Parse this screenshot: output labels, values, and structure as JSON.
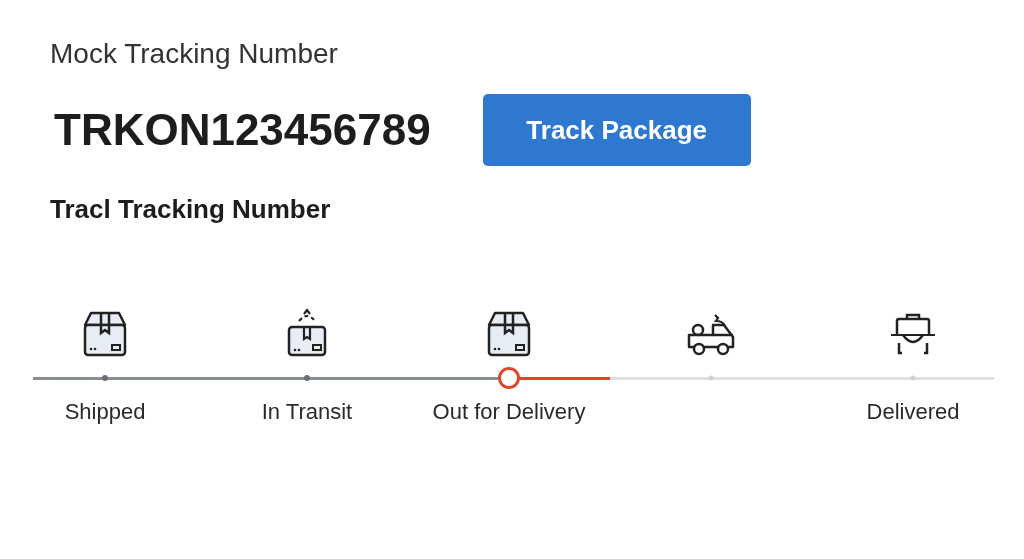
{
  "field_label": "Mock Tracking Number",
  "tracking_number": "TRKON123456789",
  "track_button": "Track Package",
  "section_title": "Tracl Tracking Number",
  "steps": [
    {
      "kind": "box",
      "label": "Shipped",
      "completed": true,
      "current": false
    },
    {
      "kind": "box-up",
      "label": "In Transit",
      "completed": true,
      "current": false
    },
    {
      "kind": "box",
      "label": "Out for Delivery",
      "completed": false,
      "current": true
    },
    {
      "kind": "truck",
      "completed": false,
      "current": false
    },
    {
      "kind": "bag",
      "label": "Delivered",
      "completed": false,
      "current": false
    }
  ]
}
